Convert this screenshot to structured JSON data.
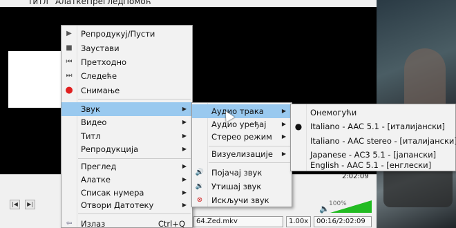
{
  "menubar": [
    "Титл",
    "Алатке",
    "Преглед",
    "Помоћ"
  ],
  "status": {
    "filename": "64.Zed.mkv",
    "speed": "1.00x",
    "time": "00:16/2:02:09",
    "duration": "2:02:09",
    "volume_percent": "100%"
  },
  "main_menu": {
    "items": [
      {
        "icon": "play-icon",
        "label": "Репродукуј/Пусти"
      },
      {
        "icon": "stop-icon",
        "label": "Заустави"
      },
      {
        "icon": "previous-icon",
        "label": "Претходно"
      },
      {
        "icon": "next-icon",
        "label": "Следеће"
      },
      {
        "icon": "record-icon",
        "label": "Снимање"
      },
      {
        "label": "Звук",
        "submenu": true,
        "highlighted": true
      },
      {
        "label": "Видео",
        "submenu": true
      },
      {
        "label": "Титл",
        "submenu": true
      },
      {
        "label": "Репродукција",
        "submenu": true
      },
      {
        "label": "Преглед",
        "submenu": true
      },
      {
        "label": "Алатке",
        "submenu": true
      },
      {
        "label": "Списак нумера",
        "submenu": true
      },
      {
        "label": "Отвори Датотеку",
        "submenu": true
      },
      {
        "icon": "exit-icon",
        "label": "Излаз",
        "shortcut": "Ctrl+Q"
      }
    ]
  },
  "audio_menu": {
    "items": [
      {
        "label": "Аудио трака",
        "submenu": true,
        "highlighted": true
      },
      {
        "label": "Аудио уређај",
        "submenu": true
      },
      {
        "label": "Стерео режим",
        "submenu": true
      },
      {
        "label": "Визуелизације",
        "submenu": true
      },
      {
        "icon": "volume-up-icon",
        "label": "Појачај звук"
      },
      {
        "icon": "volume-down-icon",
        "label": "Утишај звук"
      },
      {
        "icon": "mute-icon",
        "label": "Искључи звук"
      }
    ]
  },
  "audio_track_menu": {
    "items": [
      {
        "label": "Онемогући"
      },
      {
        "label": "Italiano - AAC 5.1 - [италијански]",
        "selected": true
      },
      {
        "label": "Italiano - AAC stereo - [италијански]"
      },
      {
        "label": "Japanese - AC3 5.1 - [јапански]"
      },
      {
        "label": "English - AAC 5.1 - [енглески]"
      }
    ]
  },
  "colors": {
    "highlight": "#99c9ef",
    "record": "#e02020",
    "volume": "#22bb22"
  }
}
